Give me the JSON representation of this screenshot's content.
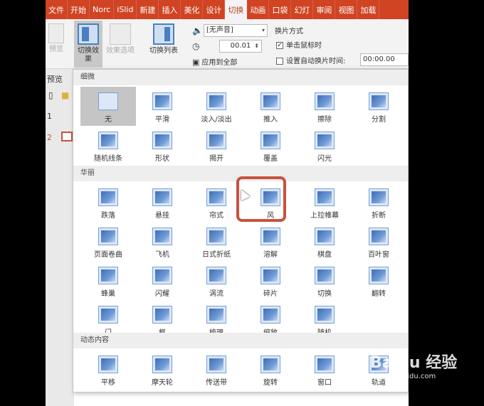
{
  "tabs": [
    "文件",
    "开始",
    "Norc",
    "iSlid",
    "新建",
    "插入",
    "美化",
    "设计",
    "切换",
    "动画",
    "口袋",
    "幻灯",
    "审阅",
    "视图",
    "加载"
  ],
  "active_tab_index": 8,
  "ribbon": {
    "preview_label": "预览",
    "effect_button_label": "切换效\n果",
    "effect_options_label": "效果选项",
    "transition_list_label": "切换列表",
    "sound_value": "[无声音]",
    "duration_value": "00.01",
    "apply_all_label": "应用到全部",
    "advance_title": "换片方式",
    "on_click_label": "单击鼠标时",
    "on_click_checked": true,
    "auto_label": "设置自动换片时间:",
    "auto_checked": false,
    "auto_value": "00:00.00"
  },
  "left_panel": {
    "preview_heading": "预览",
    "slide_numbers": [
      "1",
      "2"
    ]
  },
  "gallery": {
    "sections": [
      {
        "title": "细微",
        "items": [
          "无",
          "平滑",
          "淡入/淡出",
          "推入",
          "擦除",
          "分割",
          "随机线条",
          "形状",
          "揭开",
          "覆盖",
          "闪光"
        ]
      },
      {
        "title": "华丽",
        "items": [
          "跌落",
          "悬挂",
          "帘式",
          "风",
          "上拉帷幕",
          "折断",
          "页面卷曲",
          "飞机",
          "日式折纸",
          "溶解",
          "棋盘",
          "百叶窗",
          "蜂巢",
          "闪耀",
          "涡流",
          "碎片",
          "切换",
          "翻转",
          "门",
          "框",
          "梳理",
          "缩放",
          "随机"
        ]
      },
      {
        "title": "动态内容",
        "items": [
          "平移",
          "摩天轮",
          "传送带",
          "旋转",
          "窗口",
          "轨道"
        ]
      }
    ],
    "selected_item": "无",
    "highlighted_item": "帘式"
  },
  "watermark": {
    "logo": "Baidu 经验",
    "url": "jingyan.baidu.com"
  },
  "colors": {
    "tab_bar": "#d04423",
    "ribbon_bg": "#f3f3f3",
    "highlight_ring": "#c7533e",
    "icon_blue": "#4a7fc1"
  }
}
